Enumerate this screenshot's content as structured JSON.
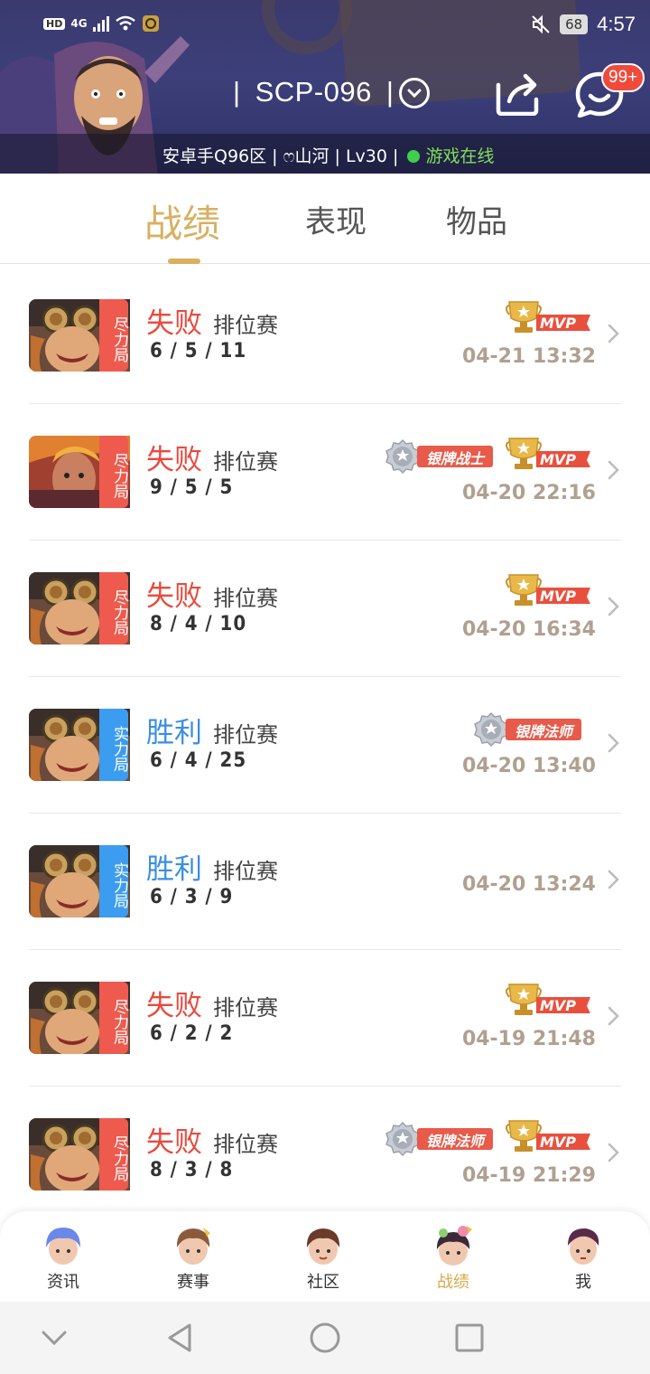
{
  "status_bar": {
    "hd": "HD",
    "network": "4G",
    "battery": "68",
    "time": "4:57"
  },
  "header": {
    "name": "SCP-096",
    "name_bars": [
      "|",
      "|"
    ],
    "info": "安卓手Q96区 | ෆ山河 | Lv30 |",
    "online_status": "游戏在线",
    "message_badge": "99+"
  },
  "tabs": [
    {
      "label": "战绩",
      "active": true
    },
    {
      "label": "表现",
      "active": false
    },
    {
      "label": "物品",
      "active": false
    }
  ],
  "matches": [
    {
      "tag": "尽力局",
      "result": "失败",
      "outcome": "lose",
      "mode": "排位赛",
      "kda": "6 / 5 / 11",
      "time": "04-21 13:32",
      "mvp": true,
      "medal": "",
      "hero": "hero-a"
    },
    {
      "tag": "尽力局",
      "result": "失败",
      "outcome": "lose",
      "mode": "排位赛",
      "kda": "9 / 5 / 5",
      "time": "04-20 22:16",
      "mvp": true,
      "medal": "银牌战士",
      "hero": "hero-b"
    },
    {
      "tag": "尽力局",
      "result": "失败",
      "outcome": "lose",
      "mode": "排位赛",
      "kda": "8 / 4 / 10",
      "time": "04-20 16:34",
      "mvp": true,
      "medal": "",
      "hero": "hero-a"
    },
    {
      "tag": "实力局",
      "result": "胜利",
      "outcome": "win",
      "mode": "排位赛",
      "kda": "6 / 4 / 25",
      "time": "04-20 13:40",
      "mvp": false,
      "medal": "银牌法师",
      "hero": "hero-a"
    },
    {
      "tag": "实力局",
      "result": "胜利",
      "outcome": "win",
      "mode": "排位赛",
      "kda": "6 / 3 / 9",
      "time": "04-20 13:24",
      "mvp": false,
      "medal": "",
      "hero": "hero-a"
    },
    {
      "tag": "尽力局",
      "result": "失败",
      "outcome": "lose",
      "mode": "排位赛",
      "kda": "6 / 2 / 2",
      "time": "04-19 21:48",
      "mvp": true,
      "medal": "",
      "hero": "hero-a"
    },
    {
      "tag": "尽力局",
      "result": "失败",
      "outcome": "lose",
      "mode": "排位赛",
      "kda": "8 / 3 / 8",
      "time": "04-19 21:29",
      "mvp": true,
      "medal": "银牌法师",
      "hero": "hero-a"
    }
  ],
  "mvp_label": "MVP",
  "bottom_nav": [
    {
      "label": "资讯",
      "active": false,
      "icon": "news-avatar-icon"
    },
    {
      "label": "赛事",
      "active": false,
      "icon": "events-avatar-icon"
    },
    {
      "label": "社区",
      "active": false,
      "icon": "community-avatar-icon"
    },
    {
      "label": "战绩",
      "active": true,
      "icon": "records-avatar-icon"
    },
    {
      "label": "我",
      "active": false,
      "icon": "profile-avatar-icon"
    }
  ],
  "colors": {
    "accent_gold": "#d8b060",
    "lose_red": "#e84a3e",
    "win_blue": "#3a8ee6",
    "online_green": "#3fcf4a",
    "badge_red": "#f04a3a"
  }
}
